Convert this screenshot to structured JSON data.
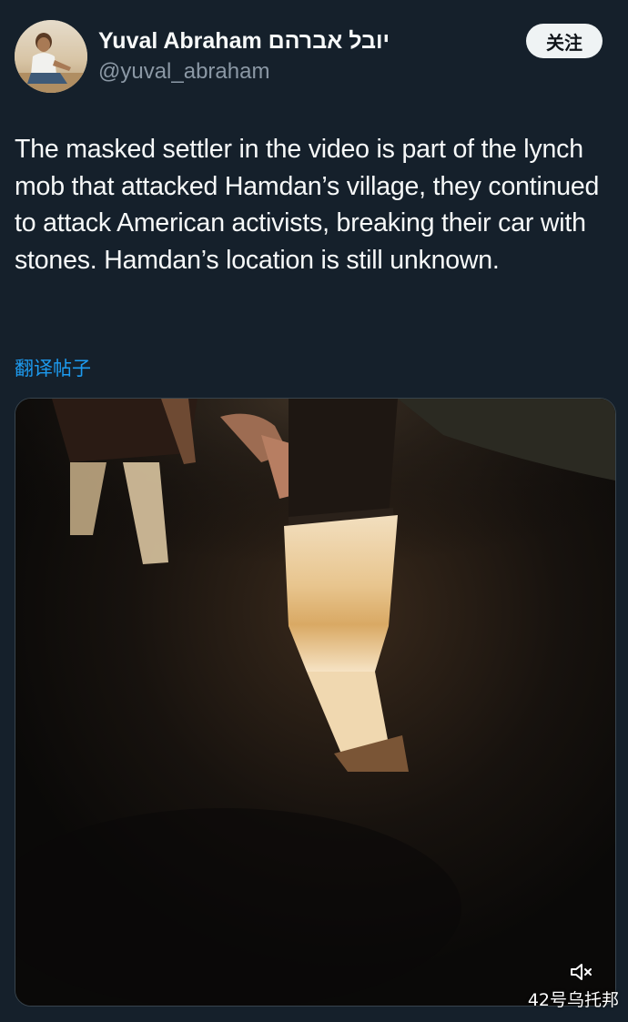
{
  "author": {
    "display_name": "Yuval Abraham יובל אברהם",
    "handle": "@yuval_abraham",
    "avatar_icon": "profile-photo"
  },
  "follow_button": {
    "label": "关注"
  },
  "tweet": {
    "text": "The masked settler in the video is part of the lynch mob that attacked Hamdan’s village, they continued to attack American activists, breaking their car with stones. Hamdan’s location is still unknown."
  },
  "translate": {
    "label": "翻译帖子"
  },
  "media": {
    "type": "video",
    "mute_icon": "volume-muted-icon"
  },
  "watermark": {
    "text": "42号乌托邦"
  },
  "colors": {
    "background": "#15202b",
    "link": "#1d9bf0",
    "secondary_text": "#8b98a5",
    "button_bg": "#eff3f4"
  }
}
